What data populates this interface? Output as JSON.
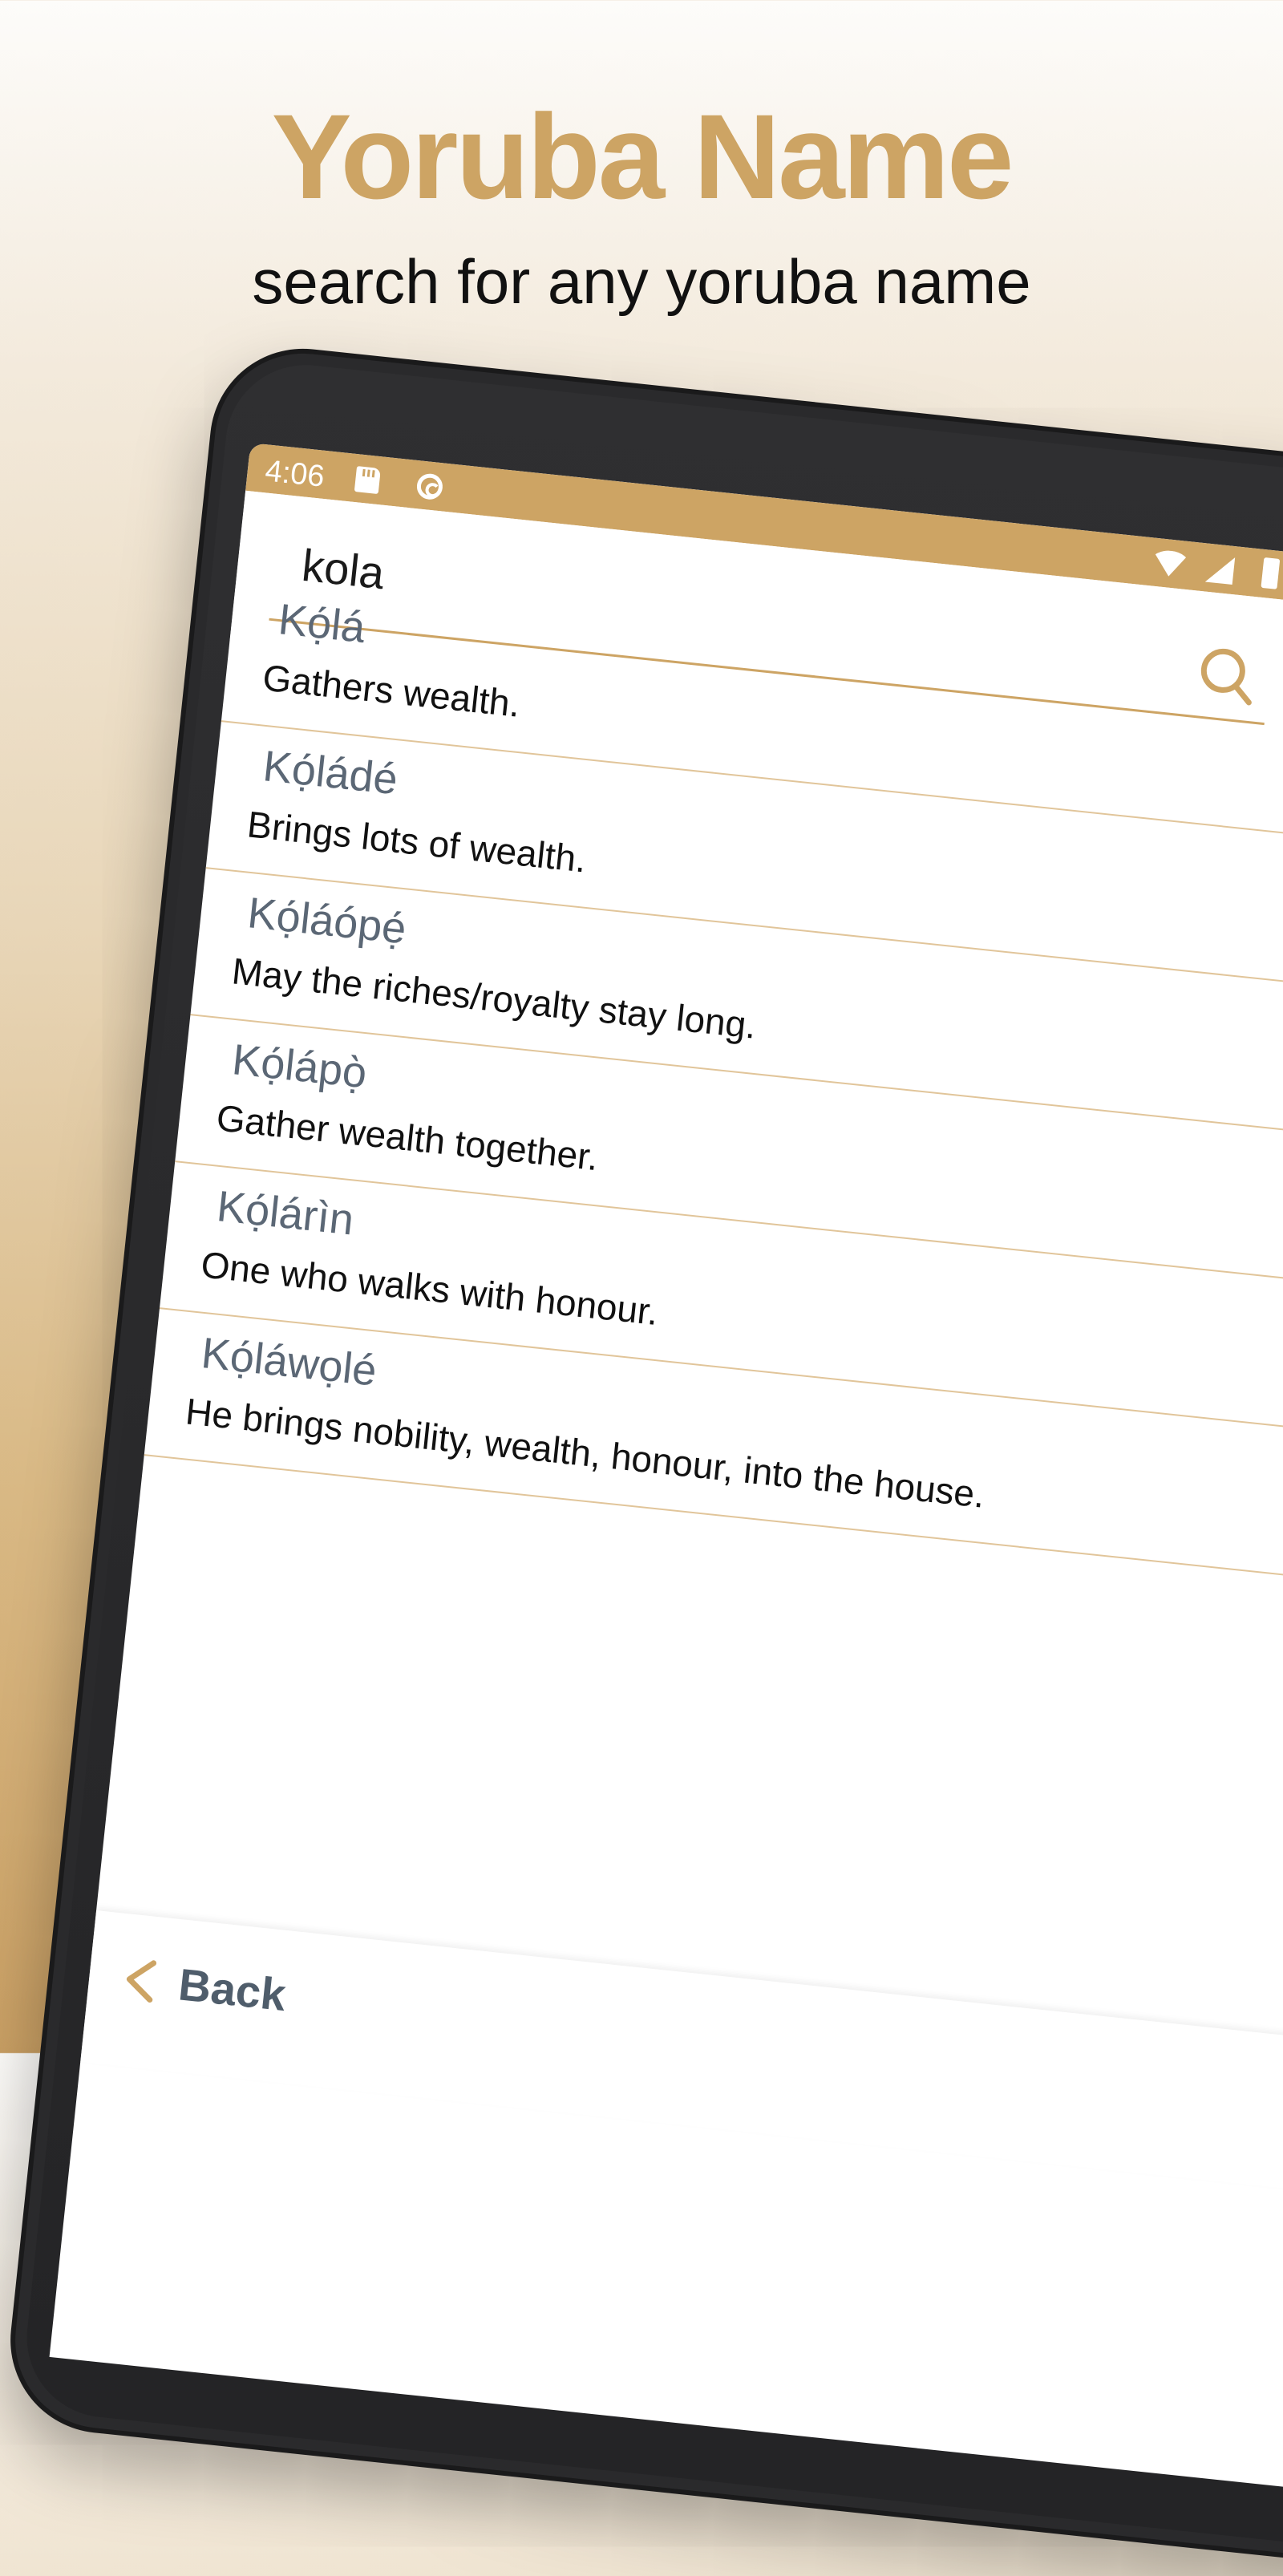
{
  "promo": {
    "title": "Yoruba Name",
    "subtitle": "search for any yoruba name"
  },
  "status_bar": {
    "time": "4:06"
  },
  "search": {
    "value": "kola"
  },
  "results": [
    {
      "name": "Kọ́lá",
      "meaning": "Gathers wealth."
    },
    {
      "name": "Kọ́ládé",
      "meaning": "Brings lots of wealth."
    },
    {
      "name": "Kọ́láópẹ́",
      "meaning": "May the riches/royalty stay long."
    },
    {
      "name": "Kọ́lápọ̀",
      "meaning": "Gather wealth together."
    },
    {
      "name": "Kọ́lárìn",
      "meaning": "One who walks with honour."
    },
    {
      "name": "Kọ́láwọlé",
      "meaning": "He brings nobility, wealth, honour, into the house."
    }
  ],
  "navigation": {
    "back_label": "Back"
  },
  "colors": {
    "accent": "#cda464",
    "name_text": "#5b6775",
    "divider": "#e1c59a"
  },
  "icons": {
    "search": "search-icon",
    "back": "chevron-left-icon",
    "storage": "sd-card-icon",
    "sync": "sync-icon",
    "wifi": "wifi-icon",
    "signal": "signal-icon",
    "battery": "battery-icon"
  }
}
